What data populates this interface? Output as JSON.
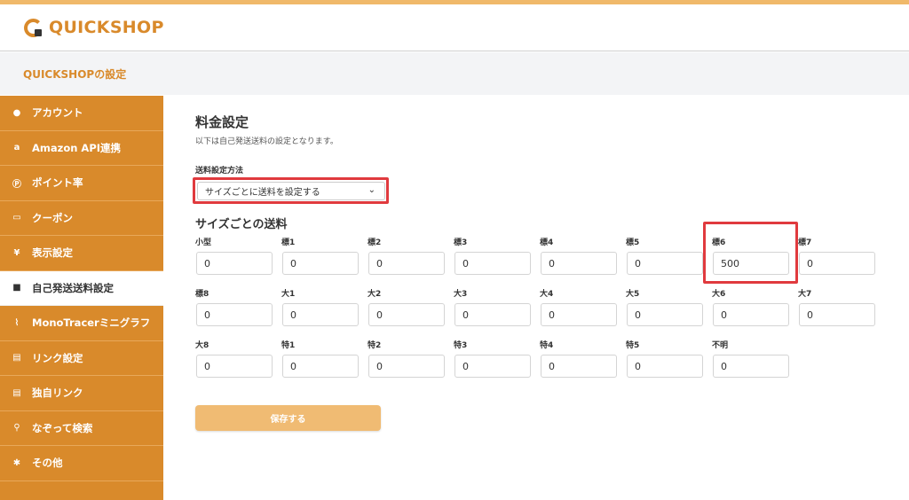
{
  "app": {
    "logo_text": "QUICKSHOP",
    "settings_title": "QUICKSHOPの設定"
  },
  "sidebar": {
    "items": [
      {
        "label": "アカウント",
        "icon": "user-icon",
        "active": false
      },
      {
        "label": "Amazon API連携",
        "icon": "amazon-icon",
        "active": false
      },
      {
        "label": "ポイント率",
        "icon": "point-icon",
        "active": false
      },
      {
        "label": "クーポン",
        "icon": "ticket-icon",
        "active": false
      },
      {
        "label": "表示設定",
        "icon": "yen-icon",
        "active": false
      },
      {
        "label": "自己発送送料設定",
        "icon": "box-icon",
        "active": true
      },
      {
        "label": "MonoTracerミニグラフ",
        "icon": "chart-icon",
        "active": false
      },
      {
        "label": "リンク設定",
        "icon": "store-icon",
        "active": false
      },
      {
        "label": "独自リンク",
        "icon": "store-icon",
        "active": false
      },
      {
        "label": "なぞって検索",
        "icon": "search-icon",
        "active": false
      },
      {
        "label": "その他",
        "icon": "gear-icon",
        "active": false
      }
    ]
  },
  "main": {
    "title": "料金設定",
    "description": "以下は自己発送送料の設定となります。",
    "method_label": "送料設定方法",
    "method_value": "サイズごとに送料を設定する",
    "section_title": "サイズごとの送料",
    "save_label": "保存する",
    "rows": [
      [
        {
          "label": "小型",
          "value": "0"
        },
        {
          "label": "標1",
          "value": "0"
        },
        {
          "label": "標2",
          "value": "0"
        },
        {
          "label": "標3",
          "value": "0"
        },
        {
          "label": "標4",
          "value": "0"
        },
        {
          "label": "標5",
          "value": "0"
        },
        {
          "label": "標6",
          "value": "500"
        },
        {
          "label": "標7",
          "value": "0"
        }
      ],
      [
        {
          "label": "標8",
          "value": "0"
        },
        {
          "label": "大1",
          "value": "0"
        },
        {
          "label": "大2",
          "value": "0"
        },
        {
          "label": "大3",
          "value": "0"
        },
        {
          "label": "大4",
          "value": "0"
        },
        {
          "label": "大5",
          "value": "0"
        },
        {
          "label": "大6",
          "value": "0"
        },
        {
          "label": "大7",
          "value": "0"
        }
      ],
      [
        {
          "label": "大8",
          "value": "0"
        },
        {
          "label": "特1",
          "value": "0"
        },
        {
          "label": "特2",
          "value": "0"
        },
        {
          "label": "特3",
          "value": "0"
        },
        {
          "label": "特4",
          "value": "0"
        },
        {
          "label": "特5",
          "value": "0"
        },
        {
          "label": "不明",
          "value": "0"
        }
      ]
    ]
  },
  "colors": {
    "accent": "#d98a2b",
    "highlight": "#e03a3e",
    "save_button": "#f0bb73"
  }
}
